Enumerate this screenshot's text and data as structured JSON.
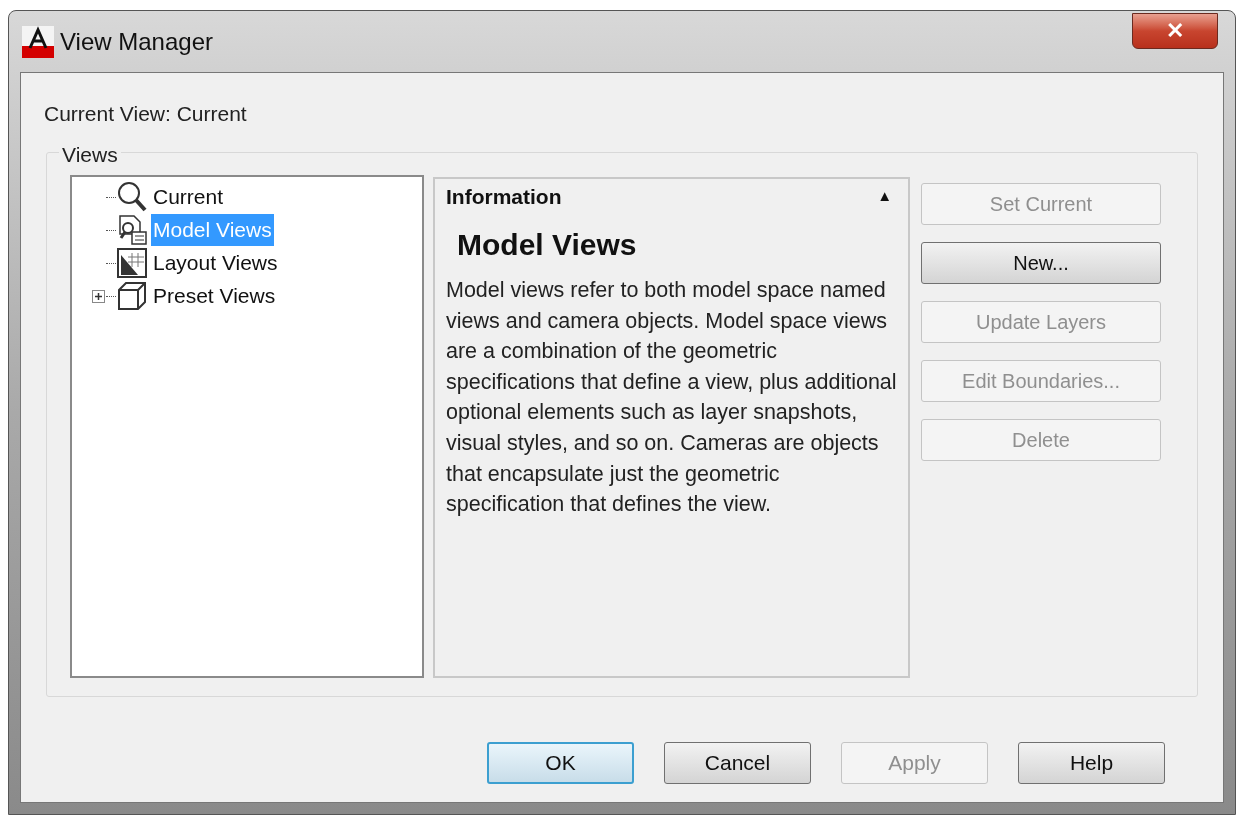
{
  "window": {
    "title": "View Manager",
    "close": "✕"
  },
  "current_view": "Current View: Current",
  "views_group": {
    "label": "Views"
  },
  "tree": {
    "items": [
      {
        "label": "Current",
        "kind": "magnifier",
        "selected": false
      },
      {
        "label": "Model Views",
        "kind": "model",
        "selected": true
      },
      {
        "label": "Layout Views",
        "kind": "layout",
        "selected": false
      },
      {
        "label": "Preset Views",
        "kind": "cube",
        "selected": false,
        "expanded": false
      }
    ]
  },
  "information": {
    "header": "Information",
    "collapse": "▲",
    "title": "Model Views",
    "text": "Model views refer to both model space named views and camera objects. Model space views are a combination of the geometric specifications that define a view, plus additional optional elements such as layer snapshots, visual styles, and so on. Cameras are objects that encapsulate just the geometric specification that defines the view."
  },
  "side_buttons": [
    {
      "label": "Set Current",
      "disabled": true
    },
    {
      "label": "New...",
      "disabled": false
    },
    {
      "label": "Update Layers",
      "disabled": true
    },
    {
      "label": "Edit Boundaries...",
      "disabled": true
    },
    {
      "label": "Delete",
      "disabled": true
    }
  ],
  "footer_buttons": [
    {
      "label": "OK",
      "disabled": false,
      "default": true
    },
    {
      "label": "Cancel",
      "disabled": false,
      "default": false
    },
    {
      "label": "Apply",
      "disabled": true,
      "default": false
    },
    {
      "label": "Help",
      "disabled": false,
      "default": false
    }
  ]
}
